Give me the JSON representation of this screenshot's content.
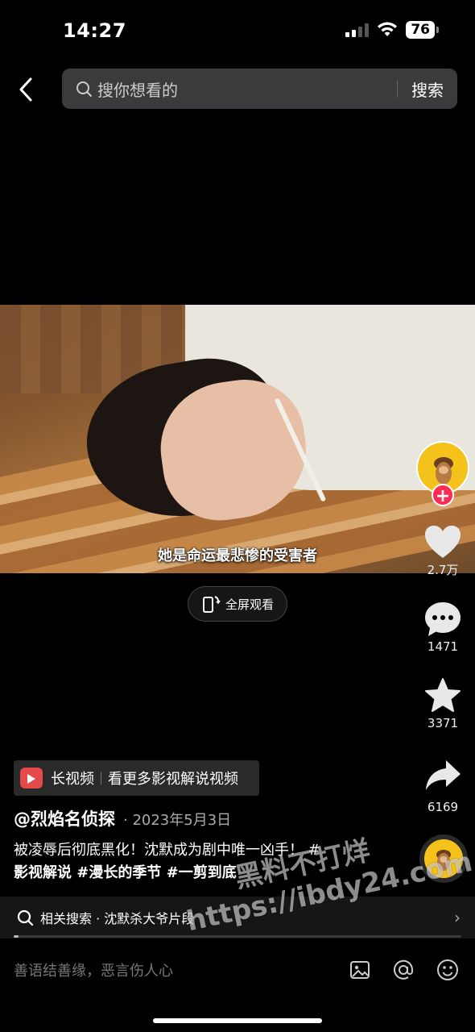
{
  "status_bar": {
    "time": "14:27",
    "battery": "76"
  },
  "search": {
    "placeholder": "搜你想看的",
    "button_label": "搜索"
  },
  "video": {
    "subtitle": "她是命运最悲惨的受害者",
    "fullscreen_label": "全屏观看"
  },
  "actions": {
    "likes": "2.7万",
    "comments": "1471",
    "favorites": "3371",
    "shares": "6169",
    "follow_symbol": "+"
  },
  "long_video": {
    "label": "长视频",
    "link": "看更多影视解说视频"
  },
  "post": {
    "author": "@烈焰名侦探",
    "date": "· 2023年5月3日",
    "caption": "被凌辱后彻底黑化！沈默成为剧中唯一凶手！ #",
    "tags": "影视解说 #漫长的季节 #一剪到底"
  },
  "related": {
    "text": "相关搜索 · 沈默杀大爷片段",
    "chevron": "›"
  },
  "playback": {
    "progress_fraction": 0.0
  },
  "comment_bar": {
    "placeholder": "善语结善缘，恶言伤人心"
  },
  "watermark": {
    "line1": "黑料不打烊",
    "line2": "https://ibdy24.com"
  },
  "colors": {
    "accent": "#fe2c55",
    "avatar": "#f4c21a"
  },
  "icons": [
    "back-arrow-icon",
    "search-icon",
    "rotate-fullscreen-icon",
    "heart-icon",
    "comment-icon",
    "star-icon",
    "share-icon",
    "image-icon",
    "at-icon",
    "emoji-icon"
  ]
}
